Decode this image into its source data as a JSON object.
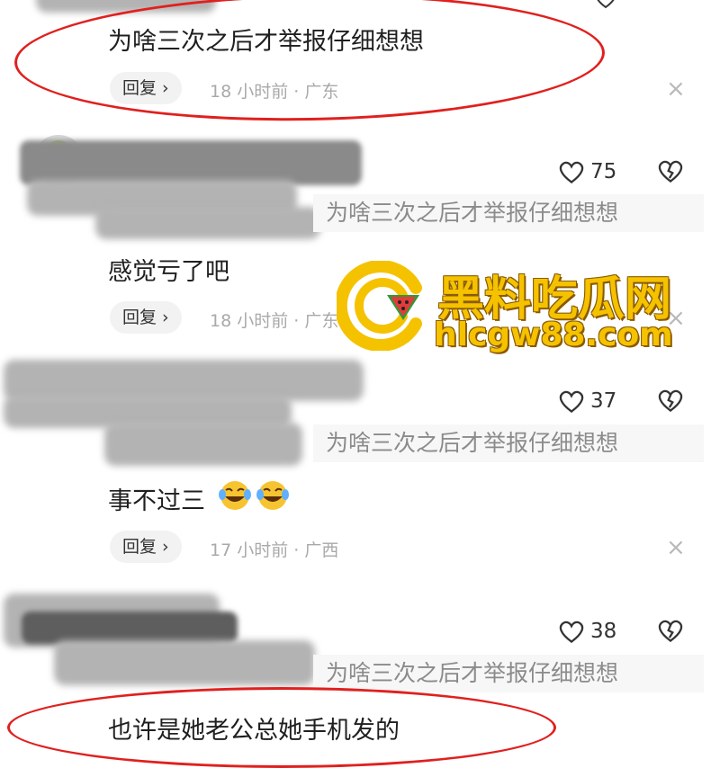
{
  "comments": [
    {
      "text": "为啥三次之后才举报仔细想想",
      "reply_label": "回复 ›",
      "meta": "18 小时前 · 广东"
    },
    {
      "likes": "75",
      "quote": "为啥三次之后才举报仔细想想",
      "text": "感觉亏了吧",
      "reply_label": "回复 ›",
      "meta": "18 小时前 · 广东"
    },
    {
      "likes": "37",
      "quote": "为啥三次之后才举报仔细想想",
      "text": "事不过三",
      "reply_label": "回复 ›",
      "meta": "17 小时前 · 广西"
    },
    {
      "likes": "38",
      "quote": "为啥三次之后才举报仔细想想",
      "text": "也许是她老公总她手机发的"
    }
  ],
  "close_symbol": "×",
  "watermark": {
    "name": "黑料吃瓜网",
    "url": "hlcgw88.com"
  },
  "colors": {
    "annotation_red": "#e0201e",
    "watermark_gold": "#f5c200"
  }
}
